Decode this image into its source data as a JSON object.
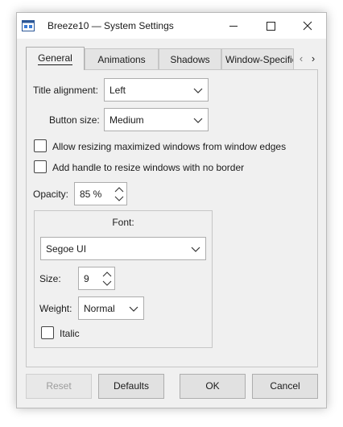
{
  "window": {
    "title": "Breeze10 — System Settings"
  },
  "tabs": [
    {
      "label": "General"
    },
    {
      "label": "Animations"
    },
    {
      "label": "Shadows"
    },
    {
      "label": "Window-Specific"
    }
  ],
  "general": {
    "title_alignment_label": "Title alignment:",
    "title_alignment_value": "Left",
    "button_size_label": "Button size:",
    "button_size_value": "Medium",
    "allow_resize_label": "Allow resizing maximized windows from window edges",
    "allow_resize_checked": false,
    "add_handle_label": "Add handle to resize windows with no border",
    "add_handle_checked": false,
    "opacity_label": "Opacity:",
    "opacity_value": "85 %"
  },
  "font_group": {
    "title": "Font:",
    "family_value": "Segoe UI",
    "size_label": "Size:",
    "size_value": "9",
    "weight_label": "Weight:",
    "weight_value": "Normal",
    "italic_label": "Italic",
    "italic_checked": false
  },
  "buttons": {
    "reset": "Reset",
    "defaults": "Defaults",
    "ok": "OK",
    "cancel": "Cancel"
  },
  "icons": {
    "app": "settings-window-icon",
    "minimize": "minimize-icon",
    "maximize": "maximize-icon",
    "close": "close-icon",
    "tab_prev": "chevron-left-icon",
    "tab_next": "chevron-right-icon",
    "combo": "chevron-down-icon",
    "spin": "spin-arrows-icon"
  }
}
